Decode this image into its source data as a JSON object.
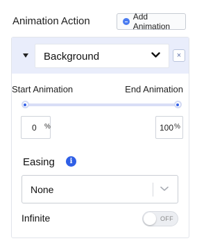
{
  "header": {
    "title": "Animation Action",
    "add_button_label": "Add Animation"
  },
  "action": {
    "selected_property": "Background",
    "close_label": "×"
  },
  "range": {
    "start_label": "Start Animation",
    "end_label": "End Animation",
    "start_value": "0",
    "end_value": "100",
    "unit": "%",
    "start_fraction": 0,
    "end_fraction": 1
  },
  "easing": {
    "label": "Easing",
    "info_glyph": "i",
    "selected": "None"
  },
  "infinite": {
    "label": "Infinite",
    "state_label": "OFF",
    "enabled": false
  },
  "colors": {
    "accent": "#2f5fe6",
    "header_bg": "#e9edfb"
  },
  "icons": [
    "plus-circle-icon",
    "caret-down-icon",
    "chevron-down-icon",
    "close-icon",
    "info-icon"
  ]
}
